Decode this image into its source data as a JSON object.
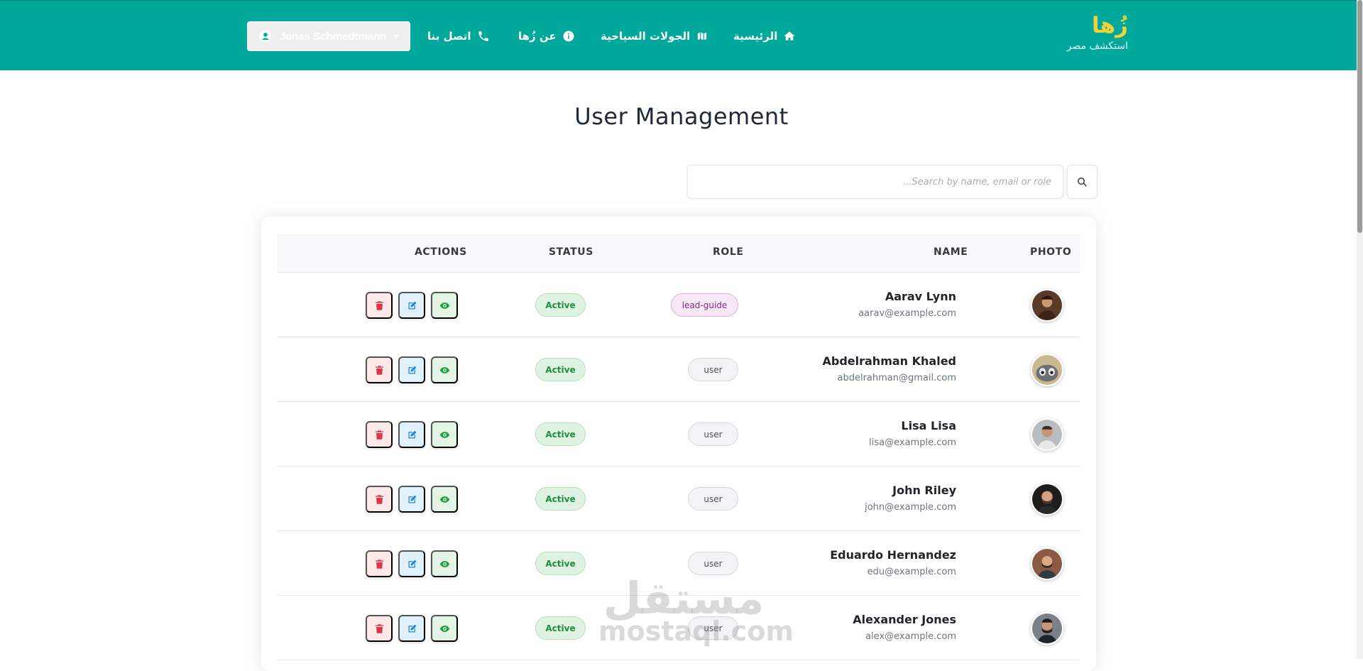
{
  "navbar": {
    "brand": {
      "name": "زُها",
      "tagline": "استكشف مصر"
    },
    "links": [
      {
        "label": "الرئيسية",
        "icon": "home-icon"
      },
      {
        "label": "الجولات السياحية",
        "icon": "map-icon"
      },
      {
        "label": "عن زُها",
        "icon": "info-icon"
      },
      {
        "label": "اتصل بنا",
        "icon": "phone-icon"
      }
    ],
    "user_menu": {
      "label": "Jonas Schmedtmann",
      "icon": "user-circle-icon"
    },
    "colors": {
      "background": "#00a89c",
      "brand": "#f2d23a"
    }
  },
  "page": {
    "title": "User Management"
  },
  "search": {
    "placeholder": "Search by name, email or role...",
    "icon": "search-icon"
  },
  "table": {
    "headers": {
      "photo": "PHOTO",
      "name": "NAME",
      "role": "ROLE",
      "status": "STATUS",
      "actions": "ACTIONS"
    },
    "rows": [
      {
        "name": "Aarav Lynn",
        "email": "aarav@example.com",
        "role": "lead-guide",
        "status": "Active"
      },
      {
        "name": "Abdelrahman Khaled",
        "email": "abdelrahman@gmail.com",
        "role": "user",
        "status": "Active"
      },
      {
        "name": "Lisa Lisa",
        "email": "lisa@example.com",
        "role": "user",
        "status": "Active"
      },
      {
        "name": "John Riley",
        "email": "john@example.com",
        "role": "user",
        "status": "Active"
      },
      {
        "name": "Eduardo Hernandez",
        "email": "edu@example.com",
        "role": "user",
        "status": "Active"
      },
      {
        "name": "Alexander Jones",
        "email": "alex@example.com",
        "role": "user",
        "status": "Active"
      }
    ],
    "action_icons": [
      "trash-icon",
      "edit-icon",
      "eye-icon"
    ]
  },
  "watermark": {
    "arabic": "مستقل",
    "latin": "mostaql.com"
  }
}
